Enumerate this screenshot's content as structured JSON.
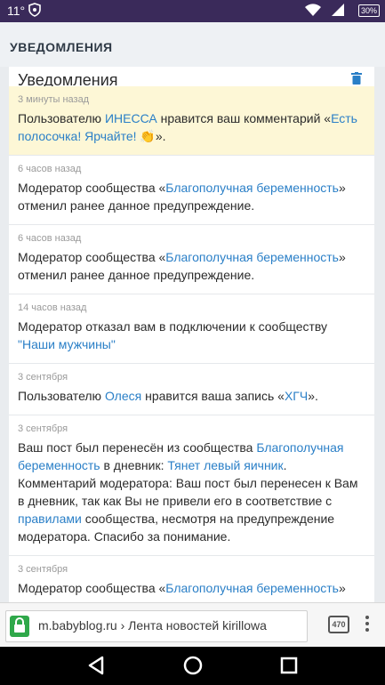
{
  "status_bar": {
    "time": "11°",
    "battery": "30%"
  },
  "header": {
    "title": "УВЕДОМЛЕНИЯ"
  },
  "panel": {
    "title": "Уведомления"
  },
  "notifications": [
    {
      "time": "3 минуты назад",
      "highlight": true,
      "parts": [
        {
          "t": "Пользователю "
        },
        {
          "t": "ИНЕССА",
          "link": true
        },
        {
          "t": " нравится ваш комментарий «"
        },
        {
          "t": "Есть полосочка! Ярчайте! 👏",
          "link": true
        },
        {
          "t": "»."
        }
      ]
    },
    {
      "time": "6 часов назад",
      "parts": [
        {
          "t": "Модератор сообщества «"
        },
        {
          "t": "Благополучная беременность",
          "link": true
        },
        {
          "t": "» отменил ранее данное предупреждение."
        }
      ]
    },
    {
      "time": "6 часов назад",
      "parts": [
        {
          "t": "Модератор сообщества «"
        },
        {
          "t": "Благополучная беременность",
          "link": true
        },
        {
          "t": "» отменил ранее данное предупреждение."
        }
      ]
    },
    {
      "time": "14 часов назад",
      "parts": [
        {
          "t": "Модератор отказал вам в подключении к сообществу "
        },
        {
          "t": "\"Наши мужчины\"",
          "link": true
        }
      ]
    },
    {
      "time": "3 сентября",
      "parts": [
        {
          "t": "Пользователю "
        },
        {
          "t": "Олеся",
          "link": true
        },
        {
          "t": " нравится ваша запись «"
        },
        {
          "t": "ХГЧ",
          "link": true
        },
        {
          "t": "»."
        }
      ]
    },
    {
      "time": "3 сентября",
      "parts": [
        {
          "t": "Ваш пост был перенесён из сообщества "
        },
        {
          "t": "Благополучная беременность",
          "link": true
        },
        {
          "t": " в дневник: "
        },
        {
          "t": "Тянет левый яичник",
          "link": true
        },
        {
          "t": ". Комментарий модератора: Ваш пост был перенесен к Вам в дневник, так как Вы не привели его в соответствие с "
        },
        {
          "t": "правилами",
          "link": true
        },
        {
          "t": " сообщества, несмотря на предупреждение модератора. Спасибо за понимание."
        }
      ]
    },
    {
      "time": "3 сентября",
      "parts": [
        {
          "t": "Модератор сообщества «"
        },
        {
          "t": "Благополучная беременность",
          "link": true
        },
        {
          "t": "»"
        }
      ]
    }
  ],
  "browser": {
    "url": "m.babyblog.ru › Лента новостей kirillowa",
    "tab_count": "470"
  },
  "colors": {
    "link": "#2a7fc7",
    "highlight": "#fdf7d6",
    "status_bar": "#3a2a5a",
    "lock": "#2fa84a"
  }
}
